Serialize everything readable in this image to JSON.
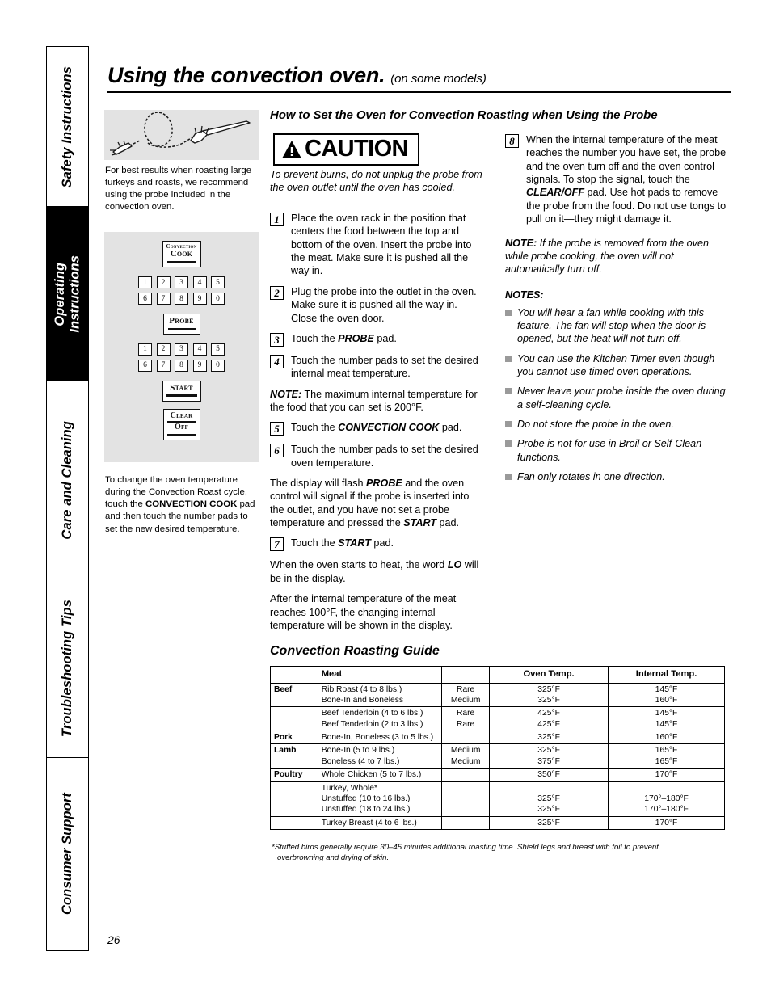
{
  "sidebar": {
    "tabs": [
      {
        "label": "Safety Instructions",
        "active": false
      },
      {
        "label": "Operating\nInstructions",
        "active": true
      },
      {
        "label": "Care and Cleaning",
        "active": false
      },
      {
        "label": "Troubleshooting Tips",
        "active": false
      },
      {
        "label": "Consumer Support",
        "active": false
      }
    ]
  },
  "header": {
    "title": "Using the convection oven.",
    "subtitle": "(on some models)",
    "section_heading": "How to Set the Oven for Convection Roasting when Using the Probe"
  },
  "figures": {
    "probe_caption": "For best results when roasting large turkeys and roasts, we recommend using the probe included in the convection oven.",
    "panel_caption_pre": "To change the oven temperature during the Convection Roast cycle, touch the ",
    "panel_caption_bold": "CONVECTION COOK",
    "panel_caption_post": " pad and then touch the number pads to set the new desired temperature.",
    "panel_keys": {
      "convection_cook_line1": "Convection",
      "convection_cook_line2": "Cook",
      "probe": "Probe",
      "start": "Start",
      "clear": "Clear",
      "off": "Off",
      "numbers_top": [
        "1",
        "2",
        "3",
        "4",
        "5"
      ],
      "numbers_bottom": [
        "6",
        "7",
        "8",
        "9",
        "0"
      ]
    }
  },
  "caution": {
    "word": "CAUTION",
    "text": "To prevent burns, do not unplug the probe from the oven outlet until the oven has cooled."
  },
  "steps_mid": [
    {
      "num": "1",
      "text": "Place the oven rack in the position that centers the food between the top and bottom of the oven. Insert the probe into the meat. Make sure it is pushed all the way in."
    },
    {
      "num": "2",
      "text": "Plug the probe into the outlet in the oven. Make sure it is pushed all the way in. Close the oven door."
    },
    {
      "num": "3",
      "pre": "Touch the ",
      "bold": "PROBE",
      "post": " pad."
    },
    {
      "num": "4",
      "text": "Touch the number pads to set the desired internal meat temperature."
    }
  ],
  "steps_mid_2": [
    {
      "num": "5",
      "pre": "Touch the ",
      "bold": "CONVECTION COOK",
      "post": " pad."
    },
    {
      "num": "6",
      "text": "Touch the number pads to set the desired oven temperature."
    }
  ],
  "mid_notes": {
    "note_label": "NOTE:",
    "note_text": " The maximum internal temperature for the food that you can set is 200°F.",
    "display_flash_1": "The display will flash ",
    "display_flash_bold1": "PROBE",
    "display_flash_2": " and the oven control will signal if the probe is inserted into the outlet, and you have not set a probe temperature and pressed the ",
    "display_flash_bold2": "START",
    "display_flash_3": " pad.",
    "step7_num": "7",
    "step7_pre": "Touch the ",
    "step7_bold": "START",
    "step7_post": " pad.",
    "heat_pre": "When the oven starts to heat, the word ",
    "heat_bold": "LO",
    "heat_post": " will be in the display.",
    "after_text": "After the internal temperature of the meat reaches 100°F, the changing internal temperature will be shown in the display."
  },
  "right_column": {
    "step8_num": "8",
    "step8_pre": "When the internal temperature of the meat reaches the number you have set, the probe and the oven turn off and the oven control signals. To stop the signal, touch the ",
    "step8_bold": "CLEAR/OFF",
    "step8_post": " pad. Use hot pads to remove the probe from the food. Do not use tongs to pull on it—they might damage it.",
    "note_label": "NOTE:",
    "note_text": " If the probe is removed from the oven while probe cooking, the oven will not automatically turn off.",
    "notes_heading": "NOTES:",
    "notes": [
      "You will hear a fan while cooking with this feature. The fan will stop when the door is opened, but the heat will not turn off.",
      "You can use the Kitchen Timer even though you cannot use timed oven operations.",
      "Never leave your probe inside the oven during a self-cleaning cycle.",
      "Do not store the probe in the oven.",
      "Probe is not for use in Broil or Self-Clean functions.",
      "Fan only rotates in one direction."
    ]
  },
  "guide": {
    "title": "Convection Roasting Guide",
    "columns": [
      "",
      "Meat",
      "",
      "Oven Temp.",
      "Internal Temp."
    ],
    "rows": [
      {
        "category": "Beef",
        "meat": [
          "Rib Roast (4 to 8 lbs.)",
          "Bone-In and Boneless"
        ],
        "doneness": [
          "Rare",
          "Medium"
        ],
        "oven": [
          "325°F",
          "325°F"
        ],
        "internal": [
          "145°F",
          "160°F"
        ]
      },
      {
        "category": "",
        "meat": [
          "Beef Tenderloin (4 to 6 lbs.)",
          "Beef Tenderloin (2 to 3 lbs.)"
        ],
        "doneness": [
          "Rare",
          "Rare"
        ],
        "oven": [
          "425°F",
          "425°F"
        ],
        "internal": [
          "145°F",
          "145°F"
        ]
      },
      {
        "category": "Pork",
        "meat": [
          "Bone-In, Boneless (3 to 5 lbs.)"
        ],
        "doneness": [
          ""
        ],
        "oven": [
          "325°F"
        ],
        "internal": [
          "160°F"
        ]
      },
      {
        "category": "Lamb",
        "meat": [
          "Bone-In (5 to 9 lbs.)",
          "Boneless (4 to 7 lbs.)"
        ],
        "doneness": [
          "Medium",
          "Medium"
        ],
        "oven": [
          "325°F",
          "375°F"
        ],
        "internal": [
          "165°F",
          "165°F"
        ]
      },
      {
        "category": "Poultry",
        "meat": [
          "Whole Chicken (5 to 7 lbs.)"
        ],
        "doneness": [
          ""
        ],
        "oven": [
          "350°F"
        ],
        "internal": [
          "170°F"
        ]
      },
      {
        "category": "",
        "meat": [
          "Turkey, Whole*",
          "Unstuffed (10 to 16 lbs.)",
          "Unstuffed (18 to 24 lbs.)"
        ],
        "doneness": [
          ""
        ],
        "oven": [
          "",
          "325°F",
          "325°F"
        ],
        "internal": [
          "",
          "170°–180°F",
          "170°–180°F"
        ]
      },
      {
        "category": "",
        "meat": [
          "Turkey Breast (4 to 6 lbs.)"
        ],
        "doneness": [
          ""
        ],
        "oven": [
          "325°F"
        ],
        "internal": [
          "170°F"
        ]
      }
    ],
    "footnote_line1": "*Stuffed birds generally require 30–45 minutes additional roasting time. Shield legs and breast with foil to prevent",
    "footnote_line2": "overbrowning and drying of skin."
  },
  "page_number": "26"
}
